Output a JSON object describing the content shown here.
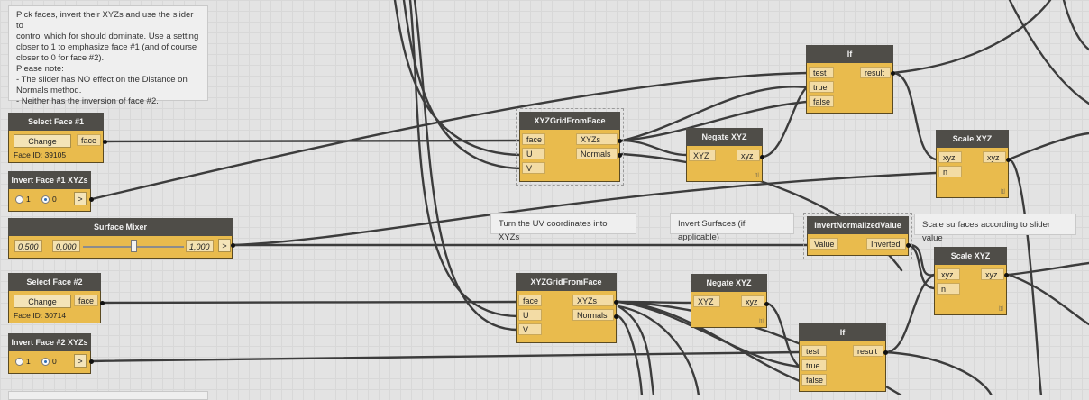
{
  "note_top": "Pick faces, invert their XYZs and use the slider to\ncontrol which for should dominate. Use a setting\ncloser to 1 to emphasize face #1 (and of course\ncloser to 0 for face #2).\nPlease note:\n- The slider has NO effect on the Distance on\nNormals method.\n- Neither has the inversion of face #2.",
  "note_uv": "Turn the UV coordinates into XYZs",
  "note_invert": "Invert Surfaces (if applicable)",
  "note_scale": "Scale surfaces according to slider value",
  "select_face_1": {
    "title": "Select Face #1",
    "button": "Change",
    "out": "face",
    "info": "Face ID: 39105"
  },
  "select_face_2": {
    "title": "Select Face #2",
    "button": "Change",
    "out": "face",
    "info": "Face ID: 30714"
  },
  "invert_face_1": {
    "title": "Invert Face #1 XYZs",
    "opt1": "1",
    "opt0": "0",
    "arrow": ">"
  },
  "invert_face_2": {
    "title": "Invert Face #2 XYZs",
    "opt1": "1",
    "opt0": "0",
    "arrow": ">"
  },
  "surface_mixer": {
    "title": "Surface Mixer",
    "value": "0,500",
    "min": "0,000",
    "max": "1,000",
    "arrow": ">",
    "slider_fraction": 0.5
  },
  "xyz_grid_1": {
    "title": "XYZGridFromFace",
    "in": [
      "face",
      "U",
      "V"
    ],
    "out": [
      "XYZs",
      "Normals"
    ]
  },
  "xyz_grid_2": {
    "title": "XYZGridFromFace",
    "in": [
      "face",
      "U",
      "V"
    ],
    "out": [
      "XYZs",
      "Normals"
    ]
  },
  "negate_1": {
    "title": "Negate XYZ",
    "in": "XYZ",
    "out": "xyz",
    "lacing": "l1l"
  },
  "negate_2": {
    "title": "Negate XYZ",
    "in": "XYZ",
    "out": "xyz",
    "lacing": "l1l"
  },
  "if_1": {
    "title": "If",
    "in": [
      "test",
      "true",
      "false"
    ],
    "out": "result"
  },
  "if_2": {
    "title": "If",
    "in": [
      "test",
      "true",
      "false"
    ],
    "out": "result"
  },
  "invert_norm": {
    "title": "InvertNormalizedValue",
    "in": "Value",
    "out": "Inverted"
  },
  "scale_1": {
    "title": "Scale XYZ",
    "in": [
      "xyz",
      "n"
    ],
    "out": "xyz",
    "lacing": "l1l"
  },
  "scale_2": {
    "title": "Scale XYZ",
    "in": [
      "xyz",
      "n"
    ],
    "out": "xyz",
    "lacing": "l1l"
  }
}
